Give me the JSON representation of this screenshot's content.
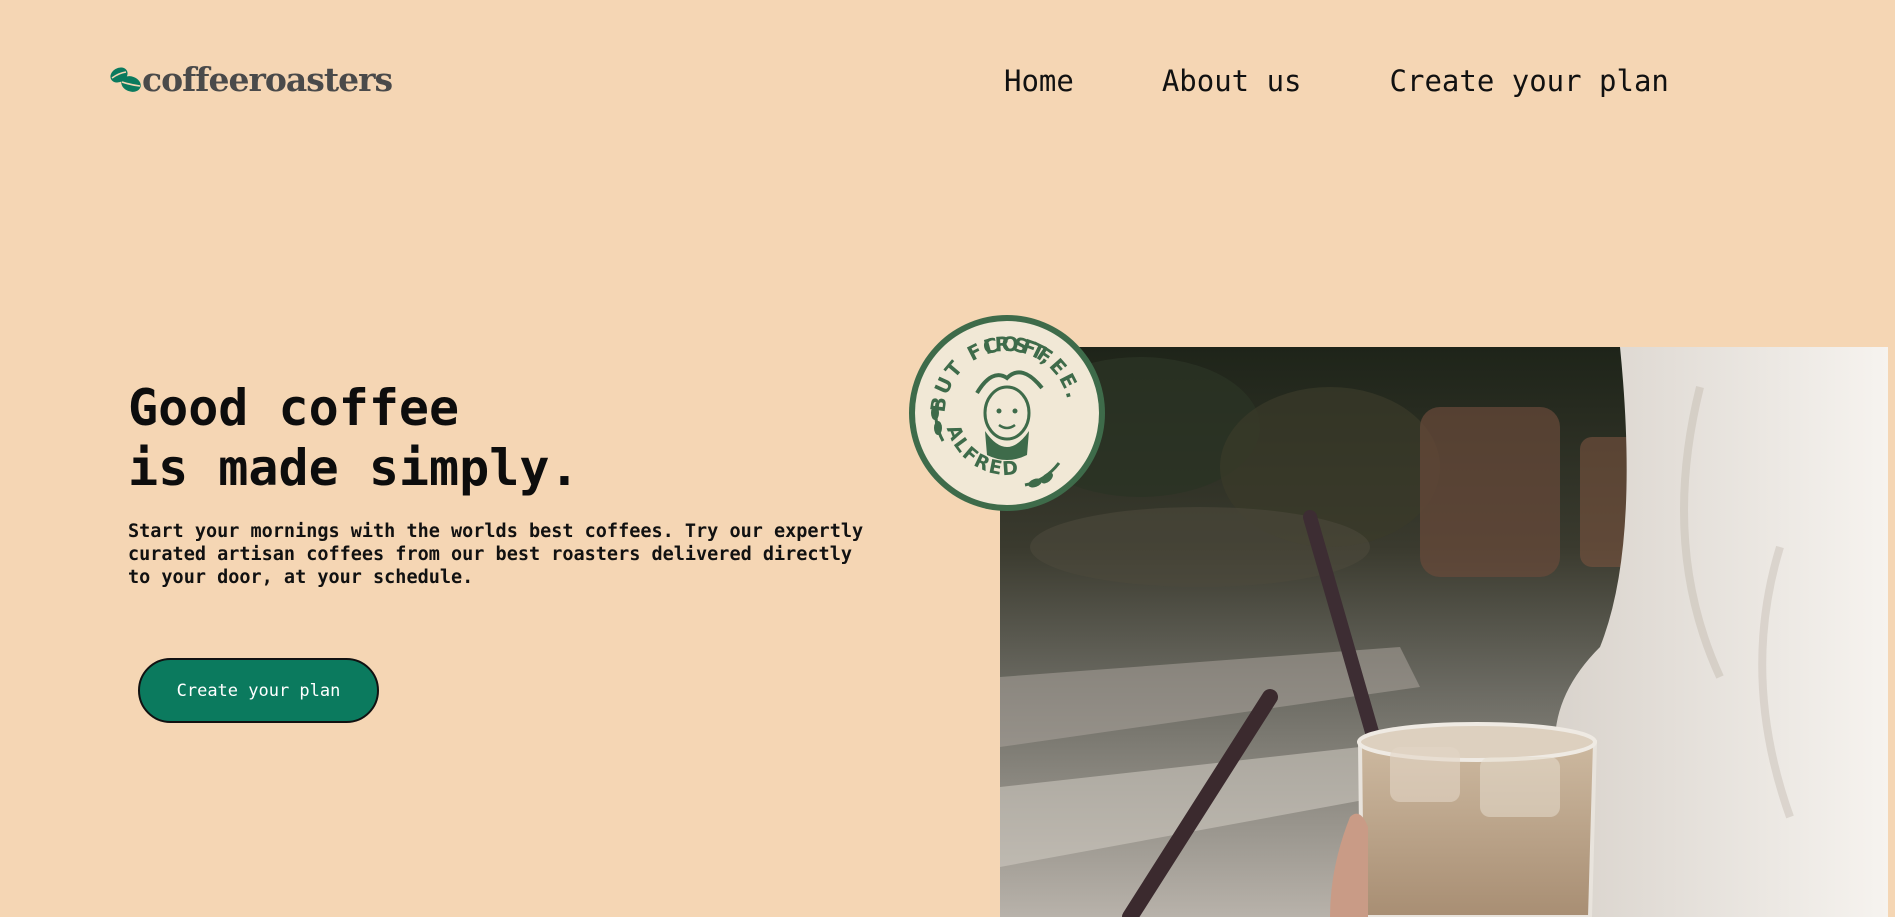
{
  "brand": {
    "name": "coffeeroasters",
    "icon": "coffee-bean-icon",
    "accent_color": "#0b7a5e",
    "background_color": "#f5d6b4"
  },
  "nav": {
    "items": [
      "Home",
      "About us",
      "Create your plan"
    ]
  },
  "hero": {
    "title_line1": "Good coffee",
    "title_line2": "is made simply.",
    "description": "Start your mornings with the worlds best coffees. Try our expertly curated artisan coffees from our best roasters delivered directly to your door, at your schedule.",
    "cta_label": "Create your plan"
  },
  "badge": {
    "text_top": "BUT FIRST, COFFEE.",
    "text_bottom": "ALFRED",
    "color": "#3e6b4a"
  },
  "photo": {
    "subject": "iced-coffee-with-straws"
  }
}
